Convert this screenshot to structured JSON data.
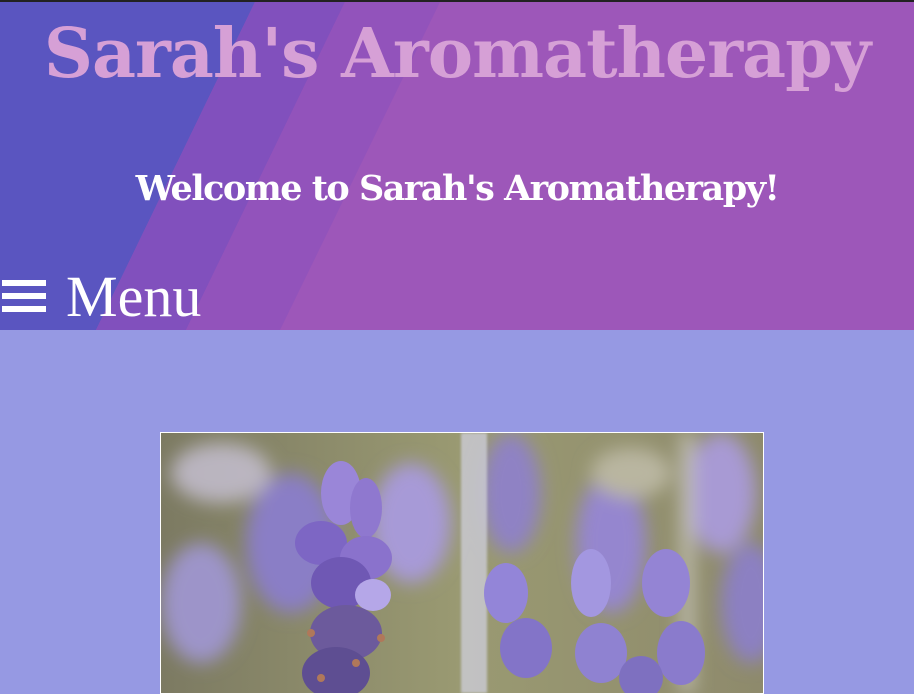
{
  "header": {
    "site_title": "Sarah's Aromatherapy",
    "welcome": "Welcome to Sarah's Aromatherapy!"
  },
  "nav": {
    "menu_label": "Menu",
    "menu_icon": "hamburger-icon"
  },
  "colors": {
    "header_bg": "#9d57b9",
    "header_stripe": "#5a55c0",
    "title_color": "#d6a0d6",
    "page_bg": "#9699e3"
  }
}
